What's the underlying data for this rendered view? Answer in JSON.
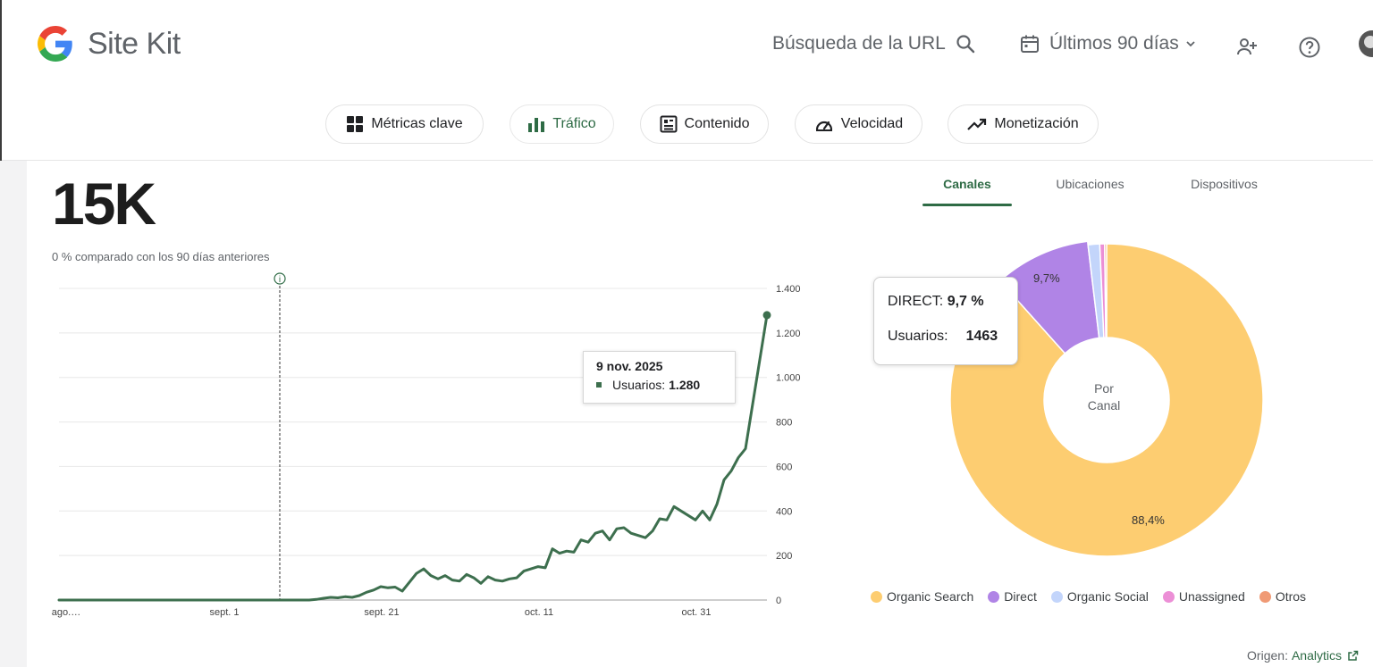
{
  "header": {
    "app_name": "Site Kit",
    "search_label": "Búsqueda de la URL",
    "date_range": "Últimos 90 días"
  },
  "nav": {
    "tabs": [
      {
        "label": "Métricas clave",
        "icon": "grid-icon"
      },
      {
        "label": "Tráfico",
        "icon": "bar-chart-icon",
        "active": true
      },
      {
        "label": "Contenido",
        "icon": "article-icon"
      },
      {
        "label": "Velocidad",
        "icon": "speedometer-icon"
      },
      {
        "label": "Monetización",
        "icon": "trending-up-icon"
      }
    ]
  },
  "main": {
    "metric_value": "15K",
    "comparison": "0 % comparado con los 90 días anteriores"
  },
  "line_tooltip": {
    "date": "9 nov. 2025",
    "label": "Usuarios:",
    "value": "1.280"
  },
  "breakdown": {
    "tabs": [
      "Canales",
      "Ubicaciones",
      "Dispositivos"
    ],
    "active_tab": "Canales",
    "center_label_1": "Por",
    "center_label_2": "Canal",
    "slice_labels": {
      "direct": "9,7%",
      "organic_search": "88,4%"
    },
    "tooltip": {
      "title": "DIRECT:",
      "percent": "9,7 %",
      "users_label": "Usuarios:",
      "users_value": "1463"
    },
    "legend": [
      {
        "label": "Organic Search",
        "color": "#fdcd71"
      },
      {
        "label": "Direct",
        "color": "#b084e6"
      },
      {
        "label": "Organic Social",
        "color": "#c3d5fb"
      },
      {
        "label": "Unassigned",
        "color": "#ec8fd6"
      },
      {
        "label": "Otros",
        "color": "#f09a75"
      }
    ]
  },
  "footer": {
    "source_label": "Origen:",
    "source_link": "Analytics"
  },
  "chart_data": [
    {
      "type": "line",
      "x_ticks": [
        "ago.…",
        "sept. 1",
        "sept. 21",
        "oct. 11",
        "oct. 31"
      ],
      "y_ticks": [
        "0",
        "200",
        "400",
        "600",
        "800",
        "1.000",
        "1.200",
        "1.400"
      ],
      "ylim": [
        0,
        1400
      ],
      "series": [
        {
          "name": "Usuarios",
          "color": "#3d6f4e",
          "values": [
            0,
            0,
            0,
            0,
            0,
            0,
            0,
            0,
            0,
            0,
            0,
            0,
            0,
            0,
            0,
            0,
            0,
            0,
            0,
            0,
            0,
            0,
            0,
            0,
            0,
            0,
            0,
            0,
            0,
            0,
            0,
            0,
            0,
            0,
            0,
            0,
            3,
            8,
            12,
            10,
            15,
            12,
            20,
            35,
            45,
            60,
            55,
            58,
            40,
            80,
            120,
            140,
            110,
            95,
            110,
            90,
            85,
            115,
            100,
            75,
            105,
            90,
            85,
            95,
            100,
            130,
            140,
            150,
            145,
            230,
            210,
            220,
            215,
            270,
            260,
            300,
            310,
            270,
            320,
            325,
            300,
            290,
            280,
            310,
            365,
            360,
            420,
            400,
            380,
            360,
            400,
            360,
            430,
            540,
            580,
            640,
            680,
            880,
            1080,
            1280
          ]
        }
      ]
    },
    {
      "type": "pie",
      "categories": [
        "Organic Search",
        "Direct",
        "Organic Social",
        "Unassigned",
        "Otros"
      ],
      "values": [
        88.4,
        9.7,
        1.2,
        0.5,
        0.2
      ]
    }
  ]
}
